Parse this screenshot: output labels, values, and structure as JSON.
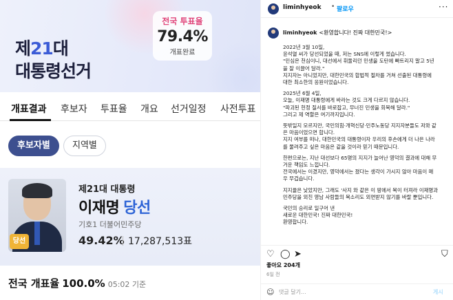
{
  "election": {
    "title_line1_prefix": "제",
    "title_line1_num": "21",
    "title_line1_suffix": "대",
    "title_line2": "대통령선거",
    "turnout_label": "전국 투표율",
    "turnout_value": "79.4%",
    "turnout_status": "개표완료",
    "tabs": [
      "개표결과",
      "후보자",
      "투표율",
      "개요",
      "선거일정",
      "사전투표"
    ],
    "filter_pills": [
      "후보자별",
      "지역별"
    ],
    "candidate": {
      "subtitle": "제21대 대통령",
      "name": "이재명",
      "result": "당선",
      "party": "기호1 더불어민주당",
      "vote_pct": "49.42%",
      "votes": "17,287,513표",
      "badge": "당선"
    },
    "counting_label": "전국 개표율",
    "counting_value": "100.0%",
    "counting_time": "05:02 기준"
  },
  "instagram": {
    "username": "liminhyeok",
    "follow_label": "팔로우",
    "more_icon": "more-icon",
    "caption_username": "liminhyeok",
    "caption_title": "<환영합니다! 진짜 대한민국!>",
    "caption_lines": [
      "2022년 3월 10일,",
      "윤석열 씨가 당선되었을 때, 저는 SNS에 이렇게 썼습니다.",
      "\"민심은 천심이니, 대선에서 휘둘리던 민생을 도탄에 빠트리지 말고 5년",
      "을 잘 이끌어 달라.\"",
      "지지자는 아니었지만, 대한민국의 합법적 절차를 거쳐 선출된 대통령에",
      "대한 최소한의 응원이었습니다.",
      "",
      "2025년 6월 4일,",
      "오늘, 이재명 대통령에게 바라는 것도 크게 다르지 않습니다.",
      "\"파괴된 헌정 질서를 바로잡고, 무너진 민생을 회복해 달라.\"",
      "그리고 제 역할은 여기까지입니다.",
      "",
      "뜻밖일지 모르지만, 국민의힘·개혁신당·민주노동당 지지자분들도 저와 같",
      "은 마음이었으면 합니다.",
      "지지 여부를 떠나, 대한민국의 대통령이자 우리의 후손에게 더 나은 나라",
      "를 물려주고 싶은 마음은 같을 것이라 믿기 때문입니다.",
      "",
      "한편으로는, 지난 대선보다 65명의 지지가 늘어난 영덕의 결과에 대해 무",
      "거운 책임도 느낍니다.",
      "전국에서는 이겼지만, 영덕에서는 졌다는 생각이 가시지 않아 마음이 매",
      "우 무겁습니다.",
      "",
      "지지율은 낮았지만, 그래도 '사지 와 같은 이 땅에서 목이 터져라 이재명과",
      "민주당을 외친 영남 사람들의 목소리도 외면받지 않기를 바랄 뿐입니다.",
      "",
      "국민의 승리로 일구어 낸",
      "새로운 대한민국! 진짜 대한민국!",
      "환영합니다."
    ],
    "likes": "좋아요 204개",
    "time_ago": "6일 전",
    "comment_placeholder": "댓글 달기...",
    "post_label": "게시"
  }
}
